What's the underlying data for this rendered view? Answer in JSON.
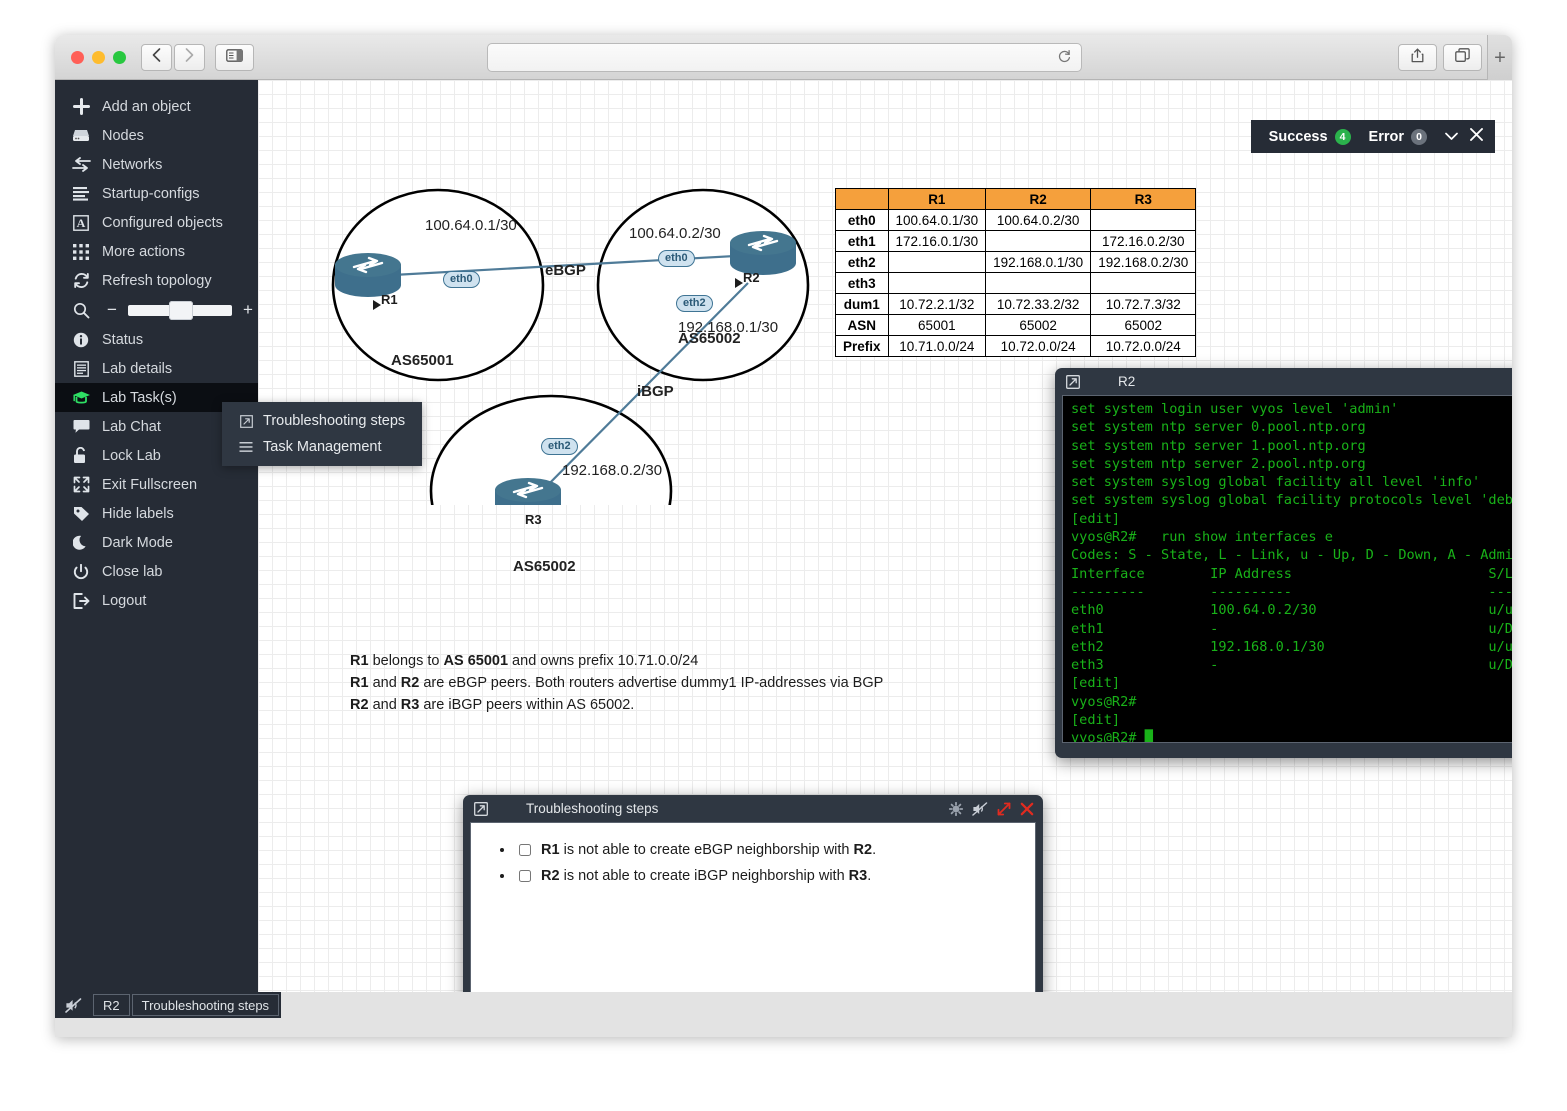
{
  "browser": {
    "back_icon": "chevron-left-icon",
    "forward_icon": "chevron-right-icon",
    "sidebar_icon": "sidebar-toggle-icon",
    "url_value": "",
    "url_placeholder": "",
    "reload_icon": "reload-icon",
    "share_icon": "share-icon",
    "tabs_icon": "tabs-icon",
    "newtab_label": "+"
  },
  "sidebar": {
    "items": [
      {
        "label": "Add an object",
        "icon": "plus-icon",
        "active": false
      },
      {
        "label": "Nodes",
        "icon": "nodes-icon",
        "active": false
      },
      {
        "label": "Networks",
        "icon": "networks-icon",
        "active": false
      },
      {
        "label": "Startup-configs",
        "icon": "list-icon",
        "active": false
      },
      {
        "label": "Configured objects",
        "icon": "letter-a-icon",
        "active": false
      },
      {
        "label": "More actions",
        "icon": "grid-icon",
        "active": false
      },
      {
        "label": "Refresh topology",
        "icon": "refresh-icon",
        "active": false
      },
      {
        "label": "Status",
        "icon": "info-icon",
        "active": false
      },
      {
        "label": "Lab details",
        "icon": "document-icon",
        "active": false
      },
      {
        "label": "Lab Task(s)",
        "icon": "graduation-icon",
        "active": true
      },
      {
        "label": "Lab Chat",
        "icon": "chat-icon",
        "active": false
      },
      {
        "label": "Lock Lab",
        "icon": "unlock-icon",
        "active": false
      },
      {
        "label": "Exit Fullscreen",
        "icon": "fullscreen-exit-icon",
        "active": false
      },
      {
        "label": "Hide labels",
        "icon": "tag-icon",
        "active": false
      },
      {
        "label": "Dark Mode",
        "icon": "moon-icon",
        "active": false
      },
      {
        "label": "Close lab",
        "icon": "power-icon",
        "active": false
      },
      {
        "label": "Logout",
        "icon": "logout-icon",
        "active": false
      }
    ],
    "zoom": {
      "icon": "zoom-search-icon",
      "minus_label": "−",
      "plus_label": "+",
      "value": 50
    }
  },
  "lab_task_menu": {
    "items": [
      {
        "label": "Troubleshooting steps",
        "icon": "popout-icon"
      },
      {
        "label": "Task Management",
        "icon": "hamburger-icon"
      }
    ]
  },
  "notifications": {
    "success_label": "Success",
    "success_count": "4",
    "error_label": "Error",
    "error_count": "0",
    "chevron_icon": "chevron-down-icon",
    "close_icon": "close-icon",
    "success_color": "#2bb24c",
    "error_color": "#6b727c"
  },
  "topology": {
    "autonomous_systems": [
      {
        "name": "AS65001"
      },
      {
        "name": "AS65002"
      },
      {
        "name": "AS65002"
      }
    ],
    "nodes": [
      {
        "name": "R1"
      },
      {
        "name": "R2"
      },
      {
        "name": "R3"
      }
    ],
    "interface_badges": [
      {
        "label": "eth0",
        "node": "R1"
      },
      {
        "label": "eth0",
        "node": "R2"
      },
      {
        "label": "eth2",
        "node": "R2"
      },
      {
        "label": "eth2",
        "node": "R3"
      }
    ],
    "link_labels": [
      {
        "text": "100.64.0.1/30"
      },
      {
        "text": "100.64.0.2/30"
      },
      {
        "text": "192.168.0.1/30"
      },
      {
        "text": "192.168.0.2/30"
      }
    ],
    "peering_labels": [
      {
        "text": "eBGP"
      },
      {
        "text": "iBGP"
      }
    ]
  },
  "description": {
    "line1_pre": "R1",
    "line1_mid": " belongs to ",
    "line1_as": "AS 65001",
    "line1_post": " and owns prefix 10.71.0.0/24",
    "line2_a": "R1",
    "line2_mid": " and ",
    "line2_b": "R2",
    "line2_post": " are eBGP peers. Both routers advertise dummy1 IP-addresses via BGP",
    "line3_a": "R2",
    "line3_mid": " and ",
    "line3_b": "R3",
    "line3_post": " are iBGP peers within AS 65002."
  },
  "ip_table": {
    "columns": [
      "",
      "R1",
      "R2",
      "R3"
    ],
    "rows": [
      {
        "header": "eth0",
        "cells": [
          "100.64.0.1/30",
          "100.64.0.2/30",
          ""
        ]
      },
      {
        "header": "eth1",
        "cells": [
          "172.16.0.1/30",
          "",
          "172.16.0.2/30"
        ]
      },
      {
        "header": "eth2",
        "cells": [
          "",
          "192.168.0.1/30",
          "192.168.0.2/30"
        ]
      },
      {
        "header": "eth3",
        "cells": [
          "",
          "",
          ""
        ]
      },
      {
        "header": "dum1",
        "cells": [
          "10.72.2.1/32",
          "10.72.33.2/32",
          "10.72.7.3/32"
        ]
      },
      {
        "header": "ASN",
        "cells": [
          "65001",
          "65002",
          "65002"
        ]
      },
      {
        "header": "Prefix",
        "cells": [
          "10.71.0.0/24",
          "10.72.0.0/24",
          "10.72.0.0/24"
        ]
      }
    ],
    "header_color": "#f5a03c"
  },
  "terminal_window": {
    "title": "R2",
    "popout_icon": "popout-icon",
    "gear_icon": "gear-icon",
    "mute_icon": "mute-icon",
    "resize_icon": "resize-icon",
    "close_icon": "close-icon",
    "content": "set system login user vyos level 'admin'\nset system ntp server 0.pool.ntp.org\nset system ntp server 1.pool.ntp.org\nset system ntp server 2.pool.ntp.org\nset system syslog global facility all level 'info'\nset system syslog global facility protocols level 'debug'\n[edit]\nvyos@R2#   run show interfaces e\nCodes: S - State, L - Link, u - Up, D - Down, A - Admin Down\nInterface        IP Address                        S/L  Description\n---------        ----------                        ---  -----------\neth0             100.64.0.2/30                     u/u\neth1             -                                 u/D\neth2             192.168.0.1/30                    u/u\neth3             -                                 u/D\n[edit]\nvyos@R2#\n[edit]\nvyos@R2# █"
  },
  "troubleshooting_window": {
    "title": "Troubleshooting steps",
    "popout_icon": "popout-icon",
    "gear_icon": "gear-icon",
    "mute_icon": "mute-icon",
    "resize_icon": "resize-icon",
    "close_icon": "close-icon",
    "steps": [
      {
        "bold_a": "R1",
        "mid": " is not able to create eBGP neighborship with ",
        "bold_b": "R2",
        "end": ".",
        "checked": false
      },
      {
        "bold_a": "R2",
        "mid": " is not able to create iBGP neighborship with ",
        "bold_b": "R3",
        "end": ".",
        "checked": false
      }
    ]
  },
  "taskbar": {
    "audio_icon": "mute-icon",
    "buttons": [
      "R2",
      "Troubleshooting steps"
    ]
  }
}
